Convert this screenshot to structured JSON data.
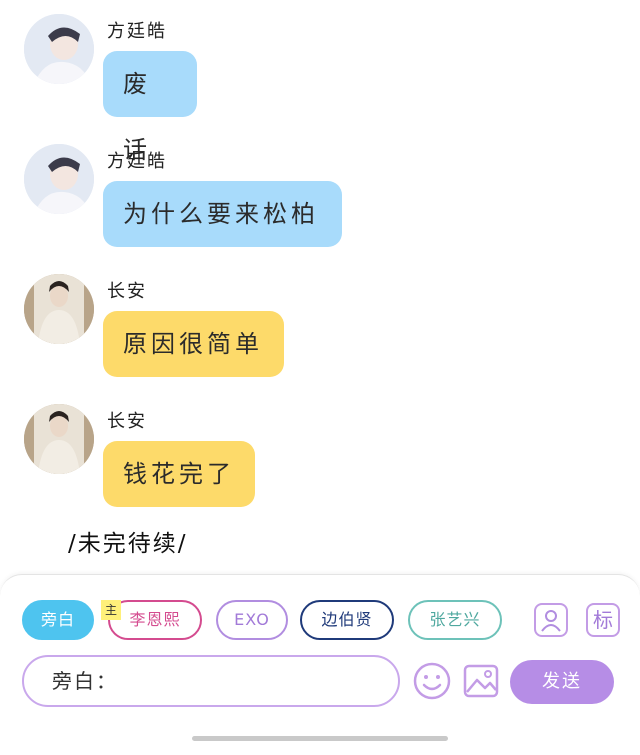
{
  "messages": [
    {
      "sender": "方廷皓",
      "text": "废话",
      "style": "blue"
    },
    {
      "sender": "方廷皓",
      "text": "为什么要来松柏",
      "style": "blue"
    },
    {
      "sender": "长安",
      "text": "原因很简单",
      "style": "yellow"
    },
    {
      "sender": "长安",
      "text": "钱花完了",
      "style": "yellow"
    }
  ],
  "footer_note": "/未完待续/",
  "speakers": {
    "narration": "旁白",
    "main_tag": "主",
    "li": "李恩熙",
    "exo": "EXO",
    "bian": "边伯贤",
    "zhang": "张艺兴"
  },
  "toolbar": {
    "mark_label": "标"
  },
  "composer": {
    "input_value": "旁白：",
    "send_label": "发送"
  },
  "colors": {
    "blue_bubble": "#a8dbfb",
    "yellow_bubble": "#fdda6a",
    "accent": "#b68de6",
    "active_chip": "#4ec4ef"
  }
}
